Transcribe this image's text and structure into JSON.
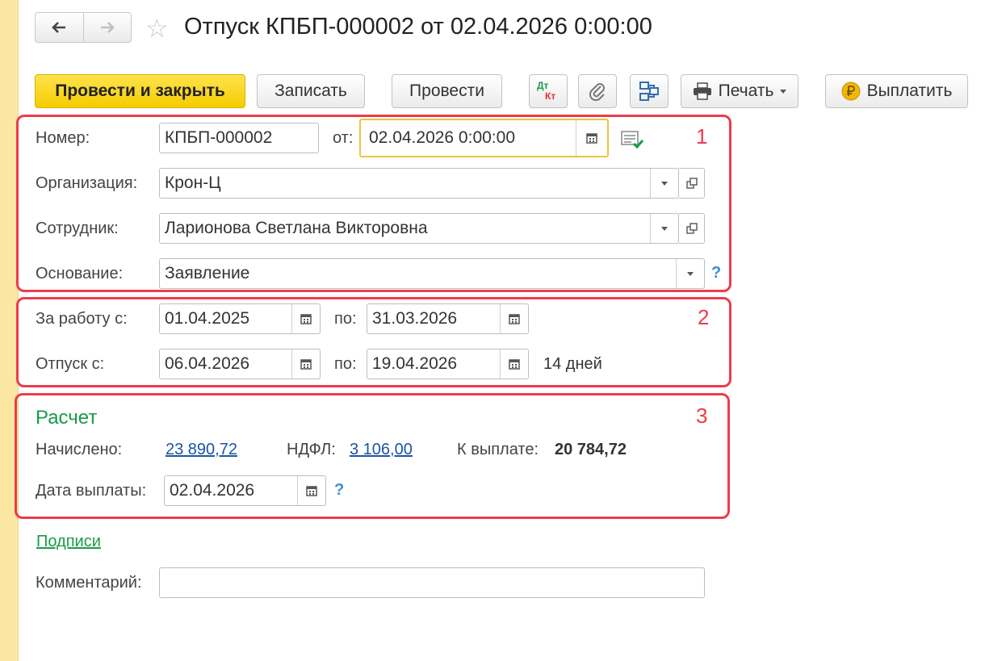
{
  "header": {
    "title": "Отпуск КПБП-000002 от 02.04.2026 0:00:00"
  },
  "toolbar": {
    "post_close_label": "Провести и закрыть",
    "save_label": "Записать",
    "post_label": "Провести",
    "dtkt_top": "Дт",
    "dtkt_bottom": "Кт",
    "print_label": "Печать",
    "pay_label": "Выплатить"
  },
  "section1": {
    "number_label": "Номер:",
    "number_value": "КПБП-000002",
    "from_label": "от:",
    "date_value": "02.04.2026  0:00:00",
    "org_label": "Организация:",
    "org_value": "Крон-Ц",
    "employee_label": "Сотрудник:",
    "employee_value": "Ларионова Светлана Викторовна",
    "basis_label": "Основание:",
    "basis_value": "Заявление",
    "marker": "1"
  },
  "section2": {
    "work_from_label": "За работу с:",
    "work_from_value": "01.04.2025",
    "work_to_label": "по:",
    "work_to_value": "31.03.2026",
    "vacation_from_label": "Отпуск с:",
    "vacation_from_value": "06.04.2026",
    "vacation_to_label": "по:",
    "vacation_to_value": "19.04.2026",
    "days_text": "14 дней",
    "marker": "2"
  },
  "section3": {
    "title": "Расчет",
    "accrued_label": "Начислено:",
    "accrued_value": "23 890,72",
    "ndfl_label": "НДФЛ:",
    "ndfl_value": "3 106,00",
    "to_pay_label": "К выплате:",
    "to_pay_value": "20 784,72",
    "pay_date_label": "Дата выплаты:",
    "pay_date_value": "02.04.2026",
    "marker": "3"
  },
  "footer": {
    "signatures_link": "Подписи",
    "comment_label": "Комментарий:",
    "comment_value": ""
  },
  "help_glyph": "?",
  "colors": {
    "accent_yellow": "#f5cc00",
    "annotation_red": "#ee3b4b",
    "link_blue": "#1b55a5",
    "section_green": "#1a9a4a",
    "focus_border": "#f2c23a"
  }
}
